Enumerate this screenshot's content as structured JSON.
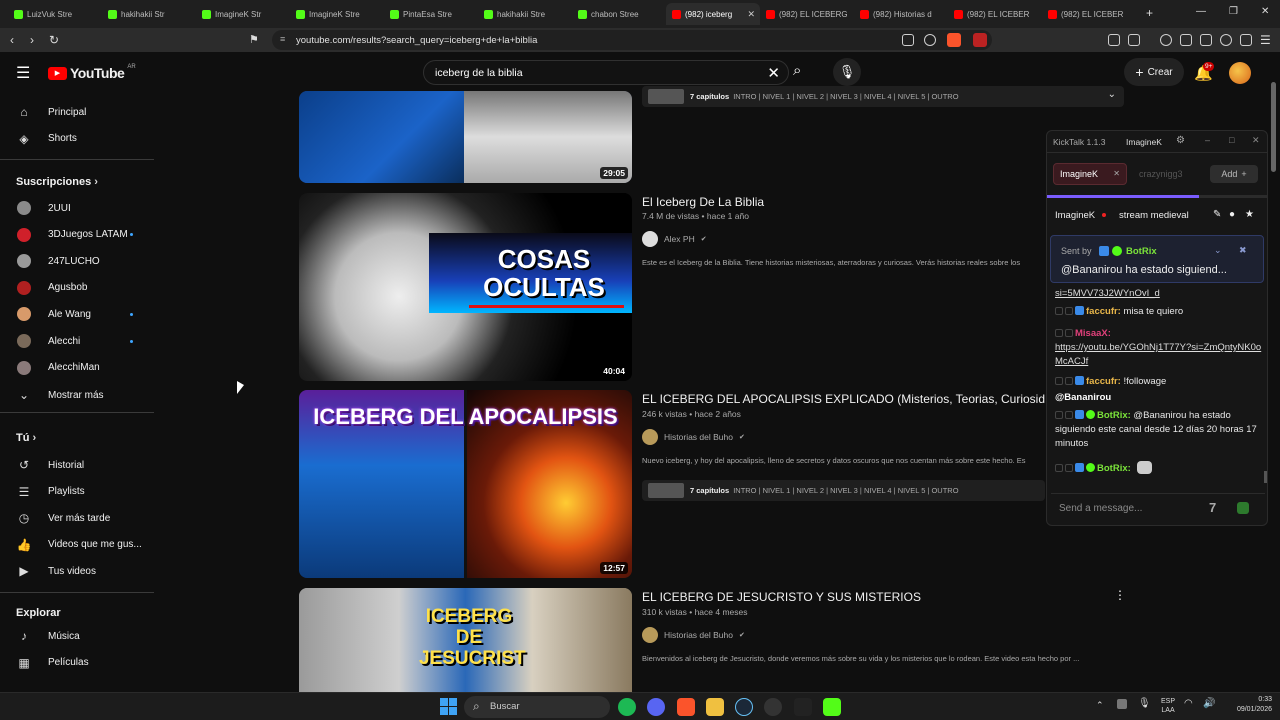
{
  "browser": {
    "tabs": [
      {
        "label": "LuizVuk Stre",
        "color": "#53fc18",
        "active": false
      },
      {
        "label": "hakihakii Str",
        "color": "#53fc18",
        "active": false
      },
      {
        "label": "ImagineK Str",
        "color": "#53fc18",
        "active": false
      },
      {
        "label": "ImagineK Stre",
        "color": "#53fc18",
        "active": false
      },
      {
        "label": "PintaEsa Stre",
        "color": "#53fc18",
        "active": false
      },
      {
        "label": "hakihakii Stre",
        "color": "#53fc18",
        "active": false
      },
      {
        "label": "chabon Stree",
        "color": "#53fc18",
        "active": false
      },
      {
        "label": "(982) iceberg",
        "color": "#ff0000",
        "active": true
      },
      {
        "label": "(982) EL ICEBERG",
        "color": "#ff0000",
        "active": false
      },
      {
        "label": "(982) Historias d",
        "color": "#ff0000",
        "active": false
      },
      {
        "label": "(982) EL ICEBER",
        "color": "#ff0000",
        "active": false
      },
      {
        "label": "(982) EL ICEBER",
        "color": "#ff0000",
        "active": false
      }
    ],
    "url": "youtube.com/results?search_query=iceberg+de+la+biblia"
  },
  "youtube": {
    "logo_text": "YouTube",
    "region": "AR",
    "search_value": "iceberg de la biblia",
    "create_label": "Crear",
    "notif_badge": "9+",
    "sidebar": {
      "main": [
        {
          "label": "Principal",
          "icon": "home-icon"
        },
        {
          "label": "Shorts",
          "icon": "shorts-icon"
        }
      ],
      "subs_heading": "Suscripciones",
      "subs": [
        {
          "label": "2UUI",
          "color": "#8a8a8a",
          "live": false
        },
        {
          "label": "3DJuegos LATAM",
          "color": "#d0202a",
          "live": true
        },
        {
          "label": "247LUCHO",
          "color": "#9a9a9a",
          "live": false
        },
        {
          "label": "Agusbob",
          "color": "#b02020",
          "live": false
        },
        {
          "label": "Ale Wang",
          "color": "#d89a6a",
          "live": true
        },
        {
          "label": "Alecchi",
          "color": "#7a6a5a",
          "live": true
        },
        {
          "label": "AlecchiMan",
          "color": "#8a7a7a",
          "live": false
        }
      ],
      "show_more": "Mostrar más",
      "you_heading": "Tú",
      "you": [
        {
          "label": "Historial",
          "icon": "history-icon"
        },
        {
          "label": "Playlists",
          "icon": "playlists-icon"
        },
        {
          "label": "Ver más tarde",
          "icon": "watch-later-icon"
        },
        {
          "label": "Videos que me gus...",
          "icon": "like-icon"
        },
        {
          "label": "Tus videos",
          "icon": "your-videos-icon"
        }
      ],
      "explore_heading": "Explorar",
      "explore": [
        {
          "label": "Música",
          "icon": "music-icon"
        },
        {
          "label": "Películas",
          "icon": "movies-icon"
        }
      ]
    },
    "results": [
      {
        "title": "",
        "duration": "29:05",
        "chapters_count": "7 capítulos",
        "chapters": "INTRO | NIVEL 1 | NIVEL 2 | NIVEL 3 | NIVEL 4 | NIVEL 5 | OUTRO"
      },
      {
        "title": "El Iceberg De La Biblia",
        "meta": "7.4 M de vistas • hace 1 año",
        "channel": "Alex PH",
        "desc": "Este es el Iceberg de la Biblia. Tiene historias misteriosas, aterradoras y curiosas. Verás historias reales sobre los",
        "duration": "40:04",
        "thumb_text": "COSAS OCULTAS"
      },
      {
        "title": "EL ICEBERG DEL APOCALIPSIS EXPLICADO (Misterios, Teorias, Curiosidade",
        "meta": "246 k vistas • hace 2 años",
        "channel": "Historias del Buho",
        "desc": "Nuevo iceberg, y hoy del apocalipsis, lleno de secretos y datos oscuros que nos cuentan más sobre este hecho. Es",
        "duration": "12:57",
        "thumb_text": "ICEBERG DEL APOCALIPSIS",
        "chapters_count": "7 capítulos",
        "chapters": "INTRO | NIVEL 1 | NIVEL 2 | NIVEL 3 | NIVEL 4 | NIVEL 5 | OUTRO"
      },
      {
        "title": "EL ICEBERG DE JESUCRISTO Y SUS MISTERIOS",
        "meta": "310 k vistas • hace 4 meses",
        "channel": "Historias del Buho",
        "desc": "Bienvenidos al iceberg de Jesucristo, donde veremos más sobre su vida y los misterios que lo rodean. Este video esta hecho por ...",
        "thumb_text": "ICEBERG DE JESUCRIST"
      }
    ]
  },
  "kicktalk": {
    "title": "KickTalk 1.1.3",
    "channel_tab": "ImagineK",
    "chat_tabs": [
      {
        "label": "ImagineK",
        "active": true
      },
      {
        "label": "crazynigg3",
        "active": false
      }
    ],
    "add_label": "Add",
    "streamer": "ImagineK",
    "stream_title": "stream medieval",
    "pinned_sent_by": "Sent by",
    "pinned_bot": "BotRix",
    "pinned_text": "@Bananirou ha estado siguiend...",
    "messages": [
      {
        "user": "",
        "text": "si=5MVV73J2WYnOvI_d",
        "kind": "link"
      },
      {
        "user": "faccufr:",
        "text": "misa te quiero",
        "kind": "msg"
      },
      {
        "user": "MisaaX:",
        "text": "",
        "kind": "msg"
      },
      {
        "user": "",
        "text": "https://youtu.be/YGOhNj1T77Y?si=ZmQntyNK0oMcACJf",
        "kind": "link"
      },
      {
        "user": "faccufr:",
        "text": "!followage",
        "kind": "msg"
      },
      {
        "user": "",
        "text": "@Bananirou",
        "kind": "mention"
      },
      {
        "user": "BotRix:",
        "text": "@Bananirou ha estado siguiendo este canal desde 12 días 20 horas 17 minutos",
        "kind": "msg"
      },
      {
        "user": "BotRix:",
        "text": "",
        "kind": "msg"
      }
    ],
    "input_placeholder": "Send a message..."
  },
  "taskbar": {
    "search_placeholder": "Buscar",
    "lang_top": "ESP",
    "lang_bottom": "LAA",
    "time": "0:33",
    "date": "09/01/2026"
  }
}
